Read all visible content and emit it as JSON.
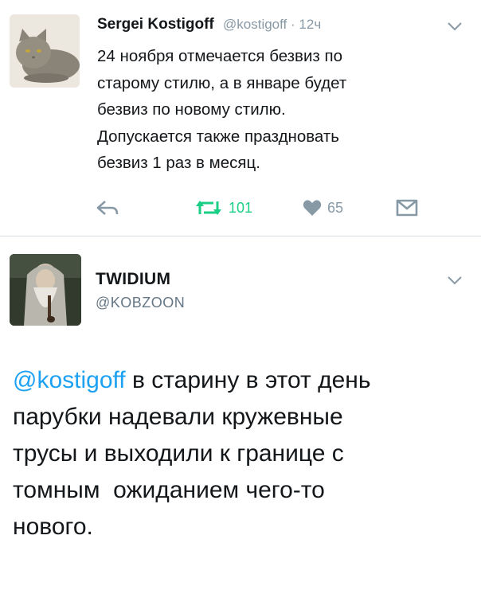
{
  "tweet1": {
    "author_name": "Sergei Kostigoff",
    "author_handle": "@kostigoff",
    "separator": "·",
    "time": "12ч",
    "text_lines": [
      "24 ноября отмечается безвиз по",
      "старому стилю, а в январе будет",
      "безвиз по новому стилю.",
      "Допускается также праздновать",
      "безвиз 1 раз в месяц."
    ],
    "actions": {
      "retweet_count": "101",
      "like_count": "65"
    },
    "icons": [
      "reply-icon",
      "retweet-icon",
      "like-icon",
      "dm-icon",
      "chevron-down-icon"
    ],
    "colors": {
      "retweet": "#19cf86",
      "muted": "#8899a6"
    }
  },
  "tweet2": {
    "author_name": "TWIDIUM",
    "author_handle": "@KOBZOON",
    "mention": "@kostigoff",
    "text_lines": [
      " в старину в этот день",
      "парубки надевали кружевные",
      "трусы и выходили к границе с",
      "томным  ожиданием чего-то",
      "нового."
    ],
    "colors": {
      "mention": "#1da1f2"
    }
  }
}
